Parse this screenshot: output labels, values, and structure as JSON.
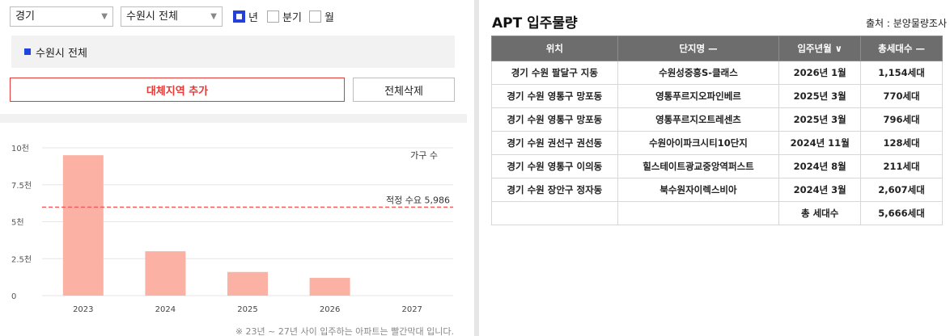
{
  "filters": {
    "province": "경기",
    "city": "수원시 전체",
    "period_options": [
      {
        "label": "년",
        "checked": true
      },
      {
        "label": "분기",
        "checked": false
      },
      {
        "label": "월",
        "checked": false
      }
    ]
  },
  "region_tag": "수원시 전체",
  "buttons": {
    "add": "대체지역 추가",
    "delete_all": "전체삭제"
  },
  "colors": {
    "bar": "#fbb2a4",
    "demand_line": "#ef5a5a",
    "accent_blue": "#2440d8",
    "add_button": "#e53935"
  },
  "chart_data": {
    "type": "bar",
    "categories": [
      "2023",
      "2024",
      "2025",
      "2026",
      "2027"
    ],
    "values": [
      9500,
      3000,
      1600,
      1200,
      0
    ],
    "ylim": [
      0,
      10000
    ],
    "yticks": [
      {
        "value": 0,
        "label": "0"
      },
      {
        "value": 2500,
        "label": "2.5천"
      },
      {
        "value": 5000,
        "label": "5천"
      },
      {
        "value": 7500,
        "label": "7.5천"
      },
      {
        "value": 10000,
        "label": "10천"
      }
    ],
    "legend": "가구 수",
    "reference_line": {
      "value": 5986,
      "label": "적정 수요 5,986"
    },
    "grid": true
  },
  "footnote": "※ 23년 ~ 27년 사이 입주하는 아파트는 빨간막대 입니다.",
  "right": {
    "title": "APT 입주물량",
    "source": "출처 : 분양물량조사",
    "columns": [
      "위치",
      "단지명 —",
      "입주년월 ∨",
      "총세대수 —"
    ],
    "rows": [
      [
        "경기 수원 팔달구 지동",
        "수원성중흥S-클래스",
        "2026년 1월",
        "1,154세대"
      ],
      [
        "경기 수원 영통구 망포동",
        "영통푸르지오파인베르",
        "2025년 3월",
        "770세대"
      ],
      [
        "경기 수원 영통구 망포동",
        "영통푸르지오트레센츠",
        "2025년 3월",
        "796세대"
      ],
      [
        "경기 수원 권선구 권선동",
        "수원아이파크시티10단지",
        "2024년 11월",
        "128세대"
      ],
      [
        "경기 수원 영통구 이의동",
        "힐스테이트광교중앙역퍼스트",
        "2024년 8월",
        "211세대"
      ],
      [
        "경기 수원 장안구 정자동",
        "북수원자이렉스비아",
        "2024년 3월",
        "2,607세대"
      ]
    ],
    "total": {
      "label": "총 세대수",
      "value": "5,666세대"
    }
  }
}
